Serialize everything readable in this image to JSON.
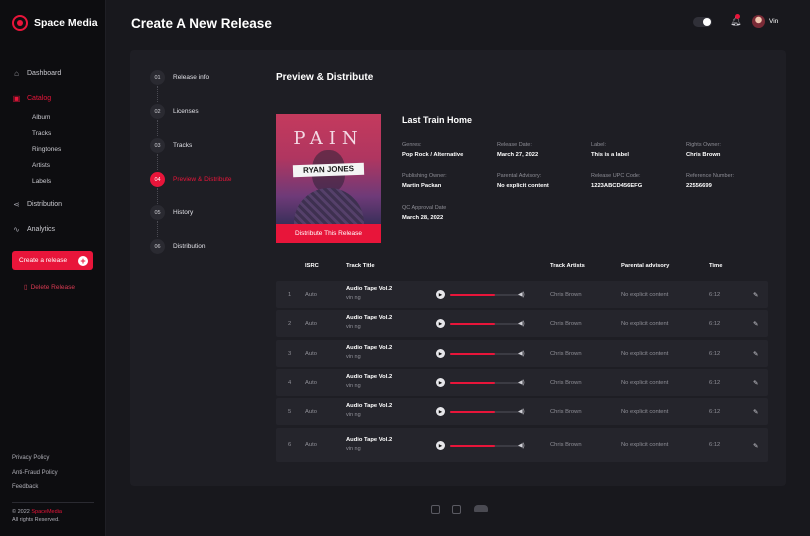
{
  "brand": {
    "name": "Space Media"
  },
  "header": {
    "title": "Create A New Release",
    "user_name": "Vin"
  },
  "sidebar": {
    "nav": [
      {
        "label": "Dashboard",
        "icon": "dashboard-icon"
      },
      {
        "label": "Catalog",
        "icon": "catalog-icon",
        "active": true
      },
      {
        "label": "Distribution",
        "icon": "share-icon"
      },
      {
        "label": "Analytics",
        "icon": "analytics-icon"
      }
    ],
    "catalog_sub": [
      "Album",
      "Tracks",
      "Ringtones",
      "Artists",
      "Labels"
    ],
    "create_button": "Create a release",
    "delete_button": "Delete Release",
    "footer_links": [
      "Privacy Policy",
      "Anti-Fraud Policy",
      "Feedback"
    ],
    "copyright_prefix": "© 2022",
    "copyright_brand": "SpaceMedia",
    "copyright_suffix": "All rights Reserved."
  },
  "steps": [
    {
      "num": "01",
      "label": "Release info"
    },
    {
      "num": "02",
      "label": "Licenses"
    },
    {
      "num": "03",
      "label": "Tracks"
    },
    {
      "num": "04",
      "label": "Preview & Distribute",
      "active": true
    },
    {
      "num": "05",
      "label": "History"
    },
    {
      "num": "06",
      "label": "Distribution"
    }
  ],
  "preview": {
    "section_title": "Preview & Distribute",
    "cover_title": "PAIN",
    "cover_artist": "RYAN JONES",
    "distribute_button": "Distribute This Release",
    "release_name": "Last Train Home",
    "meta": [
      {
        "key": "Genres:",
        "value": "Pop Rock / Alternative"
      },
      {
        "key": "Release Date:",
        "value": "March 27, 2022"
      },
      {
        "key": "Label:",
        "value": "This is a label"
      },
      {
        "key": "Rights Owner:",
        "value": "Chris Brown"
      },
      {
        "key": "Publishing Owner:",
        "value": "Martin Packan"
      },
      {
        "key": "Parental Advisory:",
        "value": "No explicit content"
      },
      {
        "key": "Release UPC Code:",
        "value": "1223ABCD456EFG"
      },
      {
        "key": "Reference Number:",
        "value": "22556699"
      },
      {
        "key": "QC Approval Date",
        "value": "March 28, 2022"
      }
    ]
  },
  "table": {
    "headers": {
      "isrc": "ISRC",
      "title": "Track Title",
      "artists": "Track Artists",
      "advisory": "Parental advisory",
      "time": "Time"
    },
    "rows": [
      {
        "num": "1",
        "isrc": "Auto",
        "title": "Audio Tape Vol.2",
        "sub": "vin ng",
        "artists": "Chris Brown",
        "advisory": "No explicit content",
        "time": "6:12",
        "progress": 0.62
      },
      {
        "num": "2",
        "isrc": "Auto",
        "title": "Audio Tape Vol.2",
        "sub": "vin ng",
        "artists": "Chris Brown",
        "advisory": "No explicit content",
        "time": "6:12",
        "progress": 0.62
      },
      {
        "num": "3",
        "isrc": "Auto",
        "title": "Audio Tape Vol.2",
        "sub": "vin ng",
        "artists": "Chris Brown",
        "advisory": "No explicit content",
        "time": "6:12",
        "progress": 0.62
      },
      {
        "num": "4",
        "isrc": "Auto",
        "title": "Audio Tape Vol.2",
        "sub": "vin ng",
        "artists": "Chris Brown",
        "advisory": "No explicit content",
        "time": "6:12",
        "progress": 0.62
      },
      {
        "num": "5",
        "isrc": "Auto",
        "title": "Audio Tape Vol.2",
        "sub": "vin ng",
        "artists": "Chris Brown",
        "advisory": "No explicit content",
        "time": "6:12",
        "progress": 0.62
      },
      {
        "num": "6",
        "isrc": "Auto",
        "title": "Audio Tape Vol.2",
        "sub": "vin ng",
        "artists": "Chris Brown",
        "advisory": "No explicit content",
        "time": "6:12",
        "progress": 0.62
      }
    ]
  },
  "colors": {
    "accent": "#e8153a",
    "background": "#18181d",
    "panel": "#1e1e24",
    "sidebar": "#0d0d10"
  }
}
